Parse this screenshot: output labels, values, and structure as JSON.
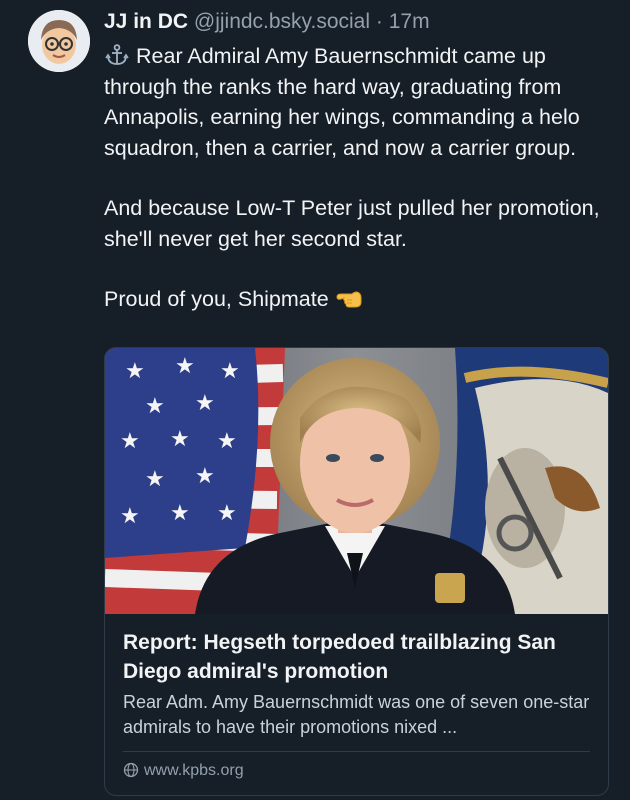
{
  "post": {
    "author": "JJ in DC",
    "handle": "@jjindc.bsky.social",
    "separator": "·",
    "time": "17m",
    "paragraphs": [
      "Rear Admiral Amy Bauernschmidt came up through the ranks the hard way, graduating from Annapolis, earning her wings, commanding a helo squadron, then a carrier, and now a carrier group.",
      "And because Low-T Peter just pulled her promotion, she'll never get her second star.",
      "Proud of you, Shipmate"
    ],
    "leading_icon": "anchor-icon",
    "trailing_icon": "backhand-index-pointing-left-emoji"
  },
  "link_card": {
    "title": "Report: Hegseth torpedoed trailblazing San Diego admiral's promotion",
    "description": "Rear Adm. Amy Bauernschmidt was one of seven one-star admirals to have their promotions nixed ...",
    "domain": "www.kpbs.org",
    "domain_icon": "globe-icon"
  }
}
